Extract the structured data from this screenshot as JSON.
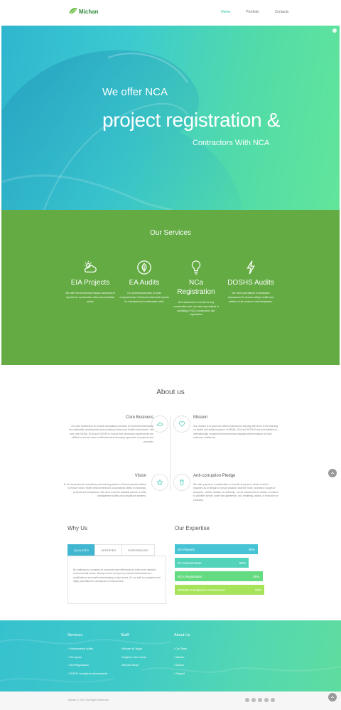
{
  "brand": {
    "name": "Michan"
  },
  "nav": {
    "items": [
      {
        "label": "Home",
        "active": true
      },
      {
        "label": "Portfolio",
        "active": false
      },
      {
        "label": "Contacts",
        "active": false
      }
    ]
  },
  "hero": {
    "line1": "We offer NCA",
    "line2": "project registration &",
    "line3": "Contractors With NCA"
  },
  "services": {
    "title": "Our Services",
    "items": [
      {
        "icon": "cloud-sun-icon",
        "name": "EIA Projects",
        "desc": "We offer Environmental Impact Assessment reports for construction sites and industrial plants"
      },
      {
        "icon": "leaf-icon",
        "name": "EA Audits",
        "desc": "Our professional team provide comprehensive Environmental Audit reports for industrial and construction sites"
      },
      {
        "icon": "lightbulb-icon",
        "name": "NCa Registration",
        "desc": "NCA clearance is crucial for any construction site, we have specialized in assisting in NCA construction site registration"
      },
      {
        "icon": "lightning-icon",
        "name": "DOSHS Audits",
        "desc": "We have specialized in workplace assessment to ensure safety, health and welfare of all workers in all workplaces."
      }
    ]
  },
  "about": {
    "title": "About us",
    "core": {
      "title": "Core Business",
      "text": "Our core business is to provide consultancy services to Environmental issues for sustainable development and providing a clean and health environment. We work with NEMA, NCA and DOSHS to ensure that necessary requirements are fulfilled to warrant issue certificates and necessary approvals on projects and premises"
    },
    "mission": {
      "title": "Mission",
      "text": "Our mission is to grow our clients business by working with them in the learning on health and safety issuance of NEMA, NCA and DOSHS and accreditation to internationally recognized environmental management techniques to instil customer confidence."
    },
    "vision": {
      "title": "Vision",
      "text": "To be the preferred consultancy and training partner to Environmental matters to ensure clean, health environment and occupational safety on buildings, projects and workplaces. We work to be the valuable partner to Gain management audits and compliance systems."
    },
    "pledge": {
      "title": "Anti-corruption Pledge",
      "text": "We offer, payment, consideration or benefit of any kind, which could be regarded as an illegal or corrupt practice, shall be made, promised, sought or accepted - neither directly nor indirectly - as an inducement or reward in relation to activities funded under this agreement, incl. tendering, award, or execution of contracts."
    }
  },
  "why": {
    "title": "Why Us",
    "tabs": [
      {
        "label": "QUALIFIED",
        "active": true
      },
      {
        "label": "CERTIFIED",
        "active": false
      },
      {
        "label": "EXPERIENCED",
        "active": false
      }
    ],
    "content": "By enabling our company to consume more effectively do even more dynamic environmental issues. Nearly a need to improve prominent standards and qualifications and staff understanding on key issues. All our staff is competent and highly specialized in all aspects of environment."
  },
  "expertise": {
    "title": "Our Expertise",
    "bars": [
      {
        "label": "EIA Reports",
        "value": 90,
        "value_text": "90%",
        "color": "#46c4d6"
      },
      {
        "label": "EA Assessments",
        "value": 80,
        "value_text": "80%",
        "color": "#53d4ba"
      },
      {
        "label": "NCA Registration",
        "value": 95,
        "value_text": "95%",
        "color": "#64db80"
      },
      {
        "label": "DOSHS Compliance Assessment",
        "value": 97,
        "value_text": "97%",
        "color": "#a6e35a"
      }
    ]
  },
  "footer": {
    "columns": [
      {
        "title": "Services",
        "items": [
          "Environmental Audits",
          "EIA reports",
          "NCA Registration",
          "DOSHS compliance Assessments"
        ]
      },
      {
        "title": "Staff",
        "items": [
          "Michael W. Ngugi",
          "Engineer Alex Hunds",
          "Bernard Ikinyo"
        ]
      },
      {
        "title": "About Us",
        "items": [
          "Our Team",
          "Mission",
          "Actions",
          "Support"
        ]
      }
    ],
    "copyright": "Michan © 2015 | All Rights Reserved"
  }
}
